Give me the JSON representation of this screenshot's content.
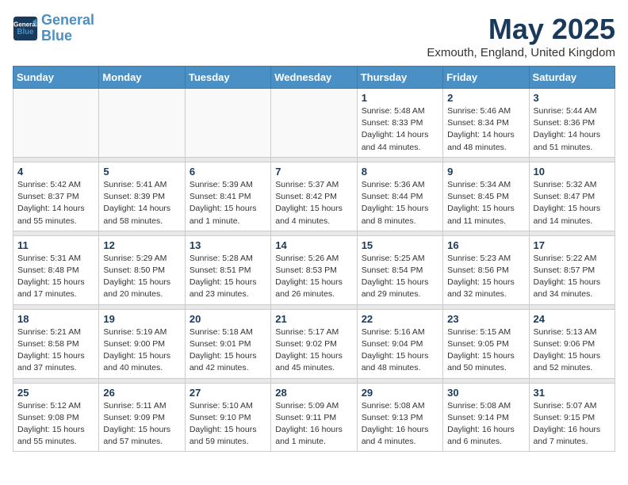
{
  "header": {
    "logo_line1": "General",
    "logo_line2": "Blue",
    "month": "May 2025",
    "location": "Exmouth, England, United Kingdom"
  },
  "weekdays": [
    "Sunday",
    "Monday",
    "Tuesday",
    "Wednesday",
    "Thursday",
    "Friday",
    "Saturday"
  ],
  "weeks": [
    [
      {
        "day": "",
        "info": ""
      },
      {
        "day": "",
        "info": ""
      },
      {
        "day": "",
        "info": ""
      },
      {
        "day": "",
        "info": ""
      },
      {
        "day": "1",
        "info": "Sunrise: 5:48 AM\nSunset: 8:33 PM\nDaylight: 14 hours\nand 44 minutes."
      },
      {
        "day": "2",
        "info": "Sunrise: 5:46 AM\nSunset: 8:34 PM\nDaylight: 14 hours\nand 48 minutes."
      },
      {
        "day": "3",
        "info": "Sunrise: 5:44 AM\nSunset: 8:36 PM\nDaylight: 14 hours\nand 51 minutes."
      }
    ],
    [
      {
        "day": "4",
        "info": "Sunrise: 5:42 AM\nSunset: 8:37 PM\nDaylight: 14 hours\nand 55 minutes."
      },
      {
        "day": "5",
        "info": "Sunrise: 5:41 AM\nSunset: 8:39 PM\nDaylight: 14 hours\nand 58 minutes."
      },
      {
        "day": "6",
        "info": "Sunrise: 5:39 AM\nSunset: 8:41 PM\nDaylight: 15 hours\nand 1 minute."
      },
      {
        "day": "7",
        "info": "Sunrise: 5:37 AM\nSunset: 8:42 PM\nDaylight: 15 hours\nand 4 minutes."
      },
      {
        "day": "8",
        "info": "Sunrise: 5:36 AM\nSunset: 8:44 PM\nDaylight: 15 hours\nand 8 minutes."
      },
      {
        "day": "9",
        "info": "Sunrise: 5:34 AM\nSunset: 8:45 PM\nDaylight: 15 hours\nand 11 minutes."
      },
      {
        "day": "10",
        "info": "Sunrise: 5:32 AM\nSunset: 8:47 PM\nDaylight: 15 hours\nand 14 minutes."
      }
    ],
    [
      {
        "day": "11",
        "info": "Sunrise: 5:31 AM\nSunset: 8:48 PM\nDaylight: 15 hours\nand 17 minutes."
      },
      {
        "day": "12",
        "info": "Sunrise: 5:29 AM\nSunset: 8:50 PM\nDaylight: 15 hours\nand 20 minutes."
      },
      {
        "day": "13",
        "info": "Sunrise: 5:28 AM\nSunset: 8:51 PM\nDaylight: 15 hours\nand 23 minutes."
      },
      {
        "day": "14",
        "info": "Sunrise: 5:26 AM\nSunset: 8:53 PM\nDaylight: 15 hours\nand 26 minutes."
      },
      {
        "day": "15",
        "info": "Sunrise: 5:25 AM\nSunset: 8:54 PM\nDaylight: 15 hours\nand 29 minutes."
      },
      {
        "day": "16",
        "info": "Sunrise: 5:23 AM\nSunset: 8:56 PM\nDaylight: 15 hours\nand 32 minutes."
      },
      {
        "day": "17",
        "info": "Sunrise: 5:22 AM\nSunset: 8:57 PM\nDaylight: 15 hours\nand 34 minutes."
      }
    ],
    [
      {
        "day": "18",
        "info": "Sunrise: 5:21 AM\nSunset: 8:58 PM\nDaylight: 15 hours\nand 37 minutes."
      },
      {
        "day": "19",
        "info": "Sunrise: 5:19 AM\nSunset: 9:00 PM\nDaylight: 15 hours\nand 40 minutes."
      },
      {
        "day": "20",
        "info": "Sunrise: 5:18 AM\nSunset: 9:01 PM\nDaylight: 15 hours\nand 42 minutes."
      },
      {
        "day": "21",
        "info": "Sunrise: 5:17 AM\nSunset: 9:02 PM\nDaylight: 15 hours\nand 45 minutes."
      },
      {
        "day": "22",
        "info": "Sunrise: 5:16 AM\nSunset: 9:04 PM\nDaylight: 15 hours\nand 48 minutes."
      },
      {
        "day": "23",
        "info": "Sunrise: 5:15 AM\nSunset: 9:05 PM\nDaylight: 15 hours\nand 50 minutes."
      },
      {
        "day": "24",
        "info": "Sunrise: 5:13 AM\nSunset: 9:06 PM\nDaylight: 15 hours\nand 52 minutes."
      }
    ],
    [
      {
        "day": "25",
        "info": "Sunrise: 5:12 AM\nSunset: 9:08 PM\nDaylight: 15 hours\nand 55 minutes."
      },
      {
        "day": "26",
        "info": "Sunrise: 5:11 AM\nSunset: 9:09 PM\nDaylight: 15 hours\nand 57 minutes."
      },
      {
        "day": "27",
        "info": "Sunrise: 5:10 AM\nSunset: 9:10 PM\nDaylight: 15 hours\nand 59 minutes."
      },
      {
        "day": "28",
        "info": "Sunrise: 5:09 AM\nSunset: 9:11 PM\nDaylight: 16 hours\nand 1 minute."
      },
      {
        "day": "29",
        "info": "Sunrise: 5:08 AM\nSunset: 9:13 PM\nDaylight: 16 hours\nand 4 minutes."
      },
      {
        "day": "30",
        "info": "Sunrise: 5:08 AM\nSunset: 9:14 PM\nDaylight: 16 hours\nand 6 minutes."
      },
      {
        "day": "31",
        "info": "Sunrise: 5:07 AM\nSunset: 9:15 PM\nDaylight: 16 hours\nand 7 minutes."
      }
    ]
  ]
}
